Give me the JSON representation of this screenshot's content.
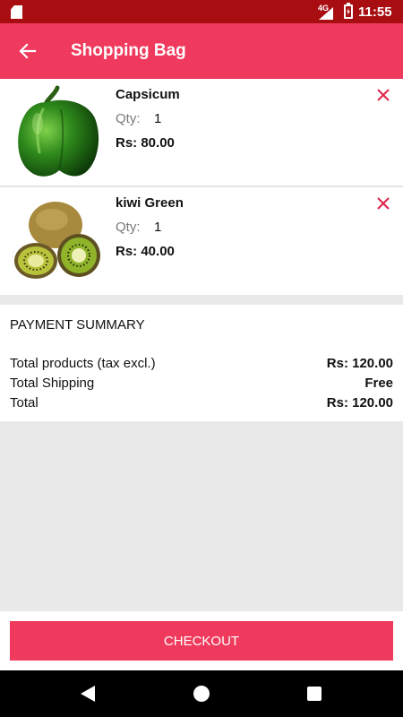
{
  "status_bar": {
    "network": "4G",
    "time": "11:55"
  },
  "app_bar": {
    "title": "Shopping Bag"
  },
  "items": [
    {
      "name": "Capsicum",
      "qty_label": "Qty:",
      "qty": "1",
      "price": "Rs: 80.00",
      "image": "capsicum-image"
    },
    {
      "name": "kiwi Green",
      "qty_label": "Qty:",
      "qty": "1",
      "price": "Rs: 40.00",
      "image": "kiwi-image"
    }
  ],
  "summary": {
    "title": "PAYMENT SUMMARY",
    "rows": [
      {
        "label": "Total products (tax excl.)",
        "value": "Rs: 120.00"
      },
      {
        "label": "Total Shipping",
        "value": "Free"
      },
      {
        "label": "Total",
        "value": "Rs: 120.00"
      }
    ]
  },
  "checkout": {
    "label": "CHECKOUT"
  },
  "colors": {
    "accent": "#ef3a5d",
    "status_bar": "#a80e11",
    "remove_icon": "#e0214a"
  }
}
